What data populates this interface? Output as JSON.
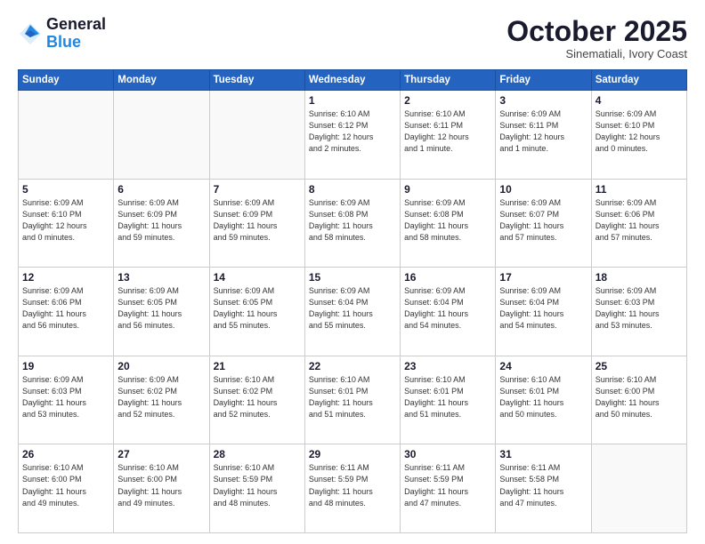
{
  "header": {
    "logo_line1": "General",
    "logo_line2": "Blue",
    "month": "October 2025",
    "location": "Sinematiali, Ivory Coast"
  },
  "weekdays": [
    "Sunday",
    "Monday",
    "Tuesday",
    "Wednesday",
    "Thursday",
    "Friday",
    "Saturday"
  ],
  "weeks": [
    [
      {
        "day": "",
        "info": ""
      },
      {
        "day": "",
        "info": ""
      },
      {
        "day": "",
        "info": ""
      },
      {
        "day": "1",
        "info": "Sunrise: 6:10 AM\nSunset: 6:12 PM\nDaylight: 12 hours\nand 2 minutes."
      },
      {
        "day": "2",
        "info": "Sunrise: 6:10 AM\nSunset: 6:11 PM\nDaylight: 12 hours\nand 1 minute."
      },
      {
        "day": "3",
        "info": "Sunrise: 6:09 AM\nSunset: 6:11 PM\nDaylight: 12 hours\nand 1 minute."
      },
      {
        "day": "4",
        "info": "Sunrise: 6:09 AM\nSunset: 6:10 PM\nDaylight: 12 hours\nand 0 minutes."
      }
    ],
    [
      {
        "day": "5",
        "info": "Sunrise: 6:09 AM\nSunset: 6:10 PM\nDaylight: 12 hours\nand 0 minutes."
      },
      {
        "day": "6",
        "info": "Sunrise: 6:09 AM\nSunset: 6:09 PM\nDaylight: 11 hours\nand 59 minutes."
      },
      {
        "day": "7",
        "info": "Sunrise: 6:09 AM\nSunset: 6:09 PM\nDaylight: 11 hours\nand 59 minutes."
      },
      {
        "day": "8",
        "info": "Sunrise: 6:09 AM\nSunset: 6:08 PM\nDaylight: 11 hours\nand 58 minutes."
      },
      {
        "day": "9",
        "info": "Sunrise: 6:09 AM\nSunset: 6:08 PM\nDaylight: 11 hours\nand 58 minutes."
      },
      {
        "day": "10",
        "info": "Sunrise: 6:09 AM\nSunset: 6:07 PM\nDaylight: 11 hours\nand 57 minutes."
      },
      {
        "day": "11",
        "info": "Sunrise: 6:09 AM\nSunset: 6:06 PM\nDaylight: 11 hours\nand 57 minutes."
      }
    ],
    [
      {
        "day": "12",
        "info": "Sunrise: 6:09 AM\nSunset: 6:06 PM\nDaylight: 11 hours\nand 56 minutes."
      },
      {
        "day": "13",
        "info": "Sunrise: 6:09 AM\nSunset: 6:05 PM\nDaylight: 11 hours\nand 56 minutes."
      },
      {
        "day": "14",
        "info": "Sunrise: 6:09 AM\nSunset: 6:05 PM\nDaylight: 11 hours\nand 55 minutes."
      },
      {
        "day": "15",
        "info": "Sunrise: 6:09 AM\nSunset: 6:04 PM\nDaylight: 11 hours\nand 55 minutes."
      },
      {
        "day": "16",
        "info": "Sunrise: 6:09 AM\nSunset: 6:04 PM\nDaylight: 11 hours\nand 54 minutes."
      },
      {
        "day": "17",
        "info": "Sunrise: 6:09 AM\nSunset: 6:04 PM\nDaylight: 11 hours\nand 54 minutes."
      },
      {
        "day": "18",
        "info": "Sunrise: 6:09 AM\nSunset: 6:03 PM\nDaylight: 11 hours\nand 53 minutes."
      }
    ],
    [
      {
        "day": "19",
        "info": "Sunrise: 6:09 AM\nSunset: 6:03 PM\nDaylight: 11 hours\nand 53 minutes."
      },
      {
        "day": "20",
        "info": "Sunrise: 6:09 AM\nSunset: 6:02 PM\nDaylight: 11 hours\nand 52 minutes."
      },
      {
        "day": "21",
        "info": "Sunrise: 6:10 AM\nSunset: 6:02 PM\nDaylight: 11 hours\nand 52 minutes."
      },
      {
        "day": "22",
        "info": "Sunrise: 6:10 AM\nSunset: 6:01 PM\nDaylight: 11 hours\nand 51 minutes."
      },
      {
        "day": "23",
        "info": "Sunrise: 6:10 AM\nSunset: 6:01 PM\nDaylight: 11 hours\nand 51 minutes."
      },
      {
        "day": "24",
        "info": "Sunrise: 6:10 AM\nSunset: 6:01 PM\nDaylight: 11 hours\nand 50 minutes."
      },
      {
        "day": "25",
        "info": "Sunrise: 6:10 AM\nSunset: 6:00 PM\nDaylight: 11 hours\nand 50 minutes."
      }
    ],
    [
      {
        "day": "26",
        "info": "Sunrise: 6:10 AM\nSunset: 6:00 PM\nDaylight: 11 hours\nand 49 minutes."
      },
      {
        "day": "27",
        "info": "Sunrise: 6:10 AM\nSunset: 6:00 PM\nDaylight: 11 hours\nand 49 minutes."
      },
      {
        "day": "28",
        "info": "Sunrise: 6:10 AM\nSunset: 5:59 PM\nDaylight: 11 hours\nand 48 minutes."
      },
      {
        "day": "29",
        "info": "Sunrise: 6:11 AM\nSunset: 5:59 PM\nDaylight: 11 hours\nand 48 minutes."
      },
      {
        "day": "30",
        "info": "Sunrise: 6:11 AM\nSunset: 5:59 PM\nDaylight: 11 hours\nand 47 minutes."
      },
      {
        "day": "31",
        "info": "Sunrise: 6:11 AM\nSunset: 5:58 PM\nDaylight: 11 hours\nand 47 minutes."
      },
      {
        "day": "",
        "info": ""
      }
    ]
  ]
}
